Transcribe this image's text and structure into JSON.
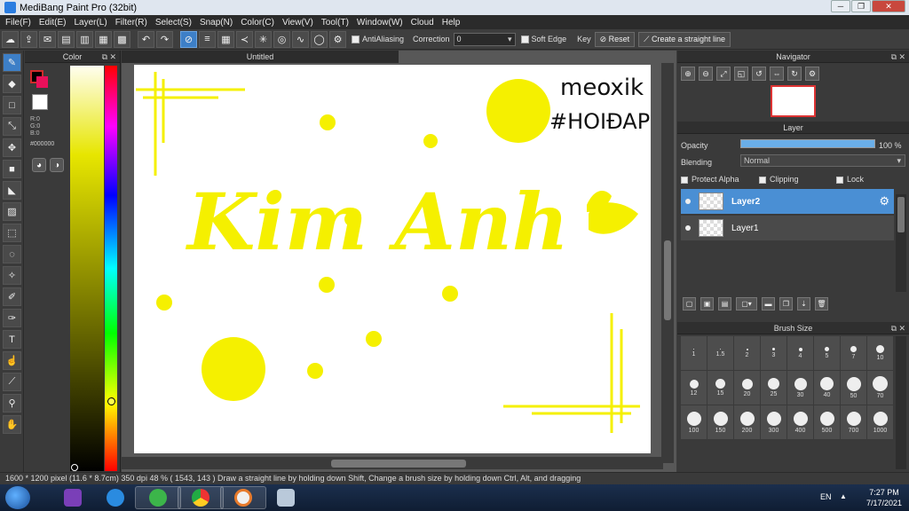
{
  "window": {
    "title": "MediBang Paint Pro (32bit)",
    "controls": [
      "─",
      "❐",
      "✕"
    ]
  },
  "menu": [
    "File(F)",
    "Edit(E)",
    "Layer(L)",
    "Filter(R)",
    "Select(S)",
    "Snap(N)",
    "Color(C)",
    "View(V)",
    "Tool(T)",
    "Window(W)",
    "Cloud",
    "Help"
  ],
  "toolbar": {
    "antialiasing_label": "AntiAliasing",
    "correction_label": "Correction",
    "correction_value": "0",
    "soft_edge_label": "Soft Edge",
    "key_label": "Key",
    "reset_label": "Reset",
    "straight_line_label": "Create a straight line"
  },
  "color_panel": {
    "title": "Color",
    "r": "R:0",
    "g": "G:0",
    "b": "B:0",
    "hex": "#000000",
    "fg_color": "#000000",
    "bg_color": "#e8105a"
  },
  "document": {
    "tab_title": "Untitled",
    "artwork": {
      "main_text": "Kim Anh",
      "signature": "meoxik",
      "hashtag": "#HOIĐAP",
      "ink_color": "#f5f000"
    }
  },
  "navigator": {
    "title": "Navigator"
  },
  "layer_panel": {
    "title": "Layer",
    "opacity_label": "Opacity",
    "opacity_value": "100 %",
    "opacity_fraction": 1.0,
    "blending_label": "Blending",
    "blending_value": "Normal",
    "protect_alpha_label": "Protect Alpha",
    "clipping_label": "Clipping",
    "lock_label": "Lock",
    "layers": [
      {
        "name": "Layer2",
        "selected": true
      },
      {
        "name": "Layer1",
        "selected": false
      }
    ]
  },
  "brush_size": {
    "title": "Brush Size",
    "sizes": [
      "1",
      "1.5",
      "2",
      "3",
      "4",
      "5",
      "7",
      "10",
      "12",
      "15",
      "20",
      "25",
      "30",
      "40",
      "50",
      "70",
      "100",
      "150",
      "200",
      "300",
      "400",
      "500",
      "700",
      "1000"
    ]
  },
  "status": {
    "text": "1600 * 1200 pixel   (11.6 * 8.7cm)   350 dpi   48 %   ( 1543, 143 )   Draw a straight line by holding down Shift, Change a brush size by holding down Ctrl, Alt, and dragging"
  },
  "taskbar": {
    "lang": "EN",
    "time": "7:27 PM",
    "date": "7/17/2021"
  }
}
